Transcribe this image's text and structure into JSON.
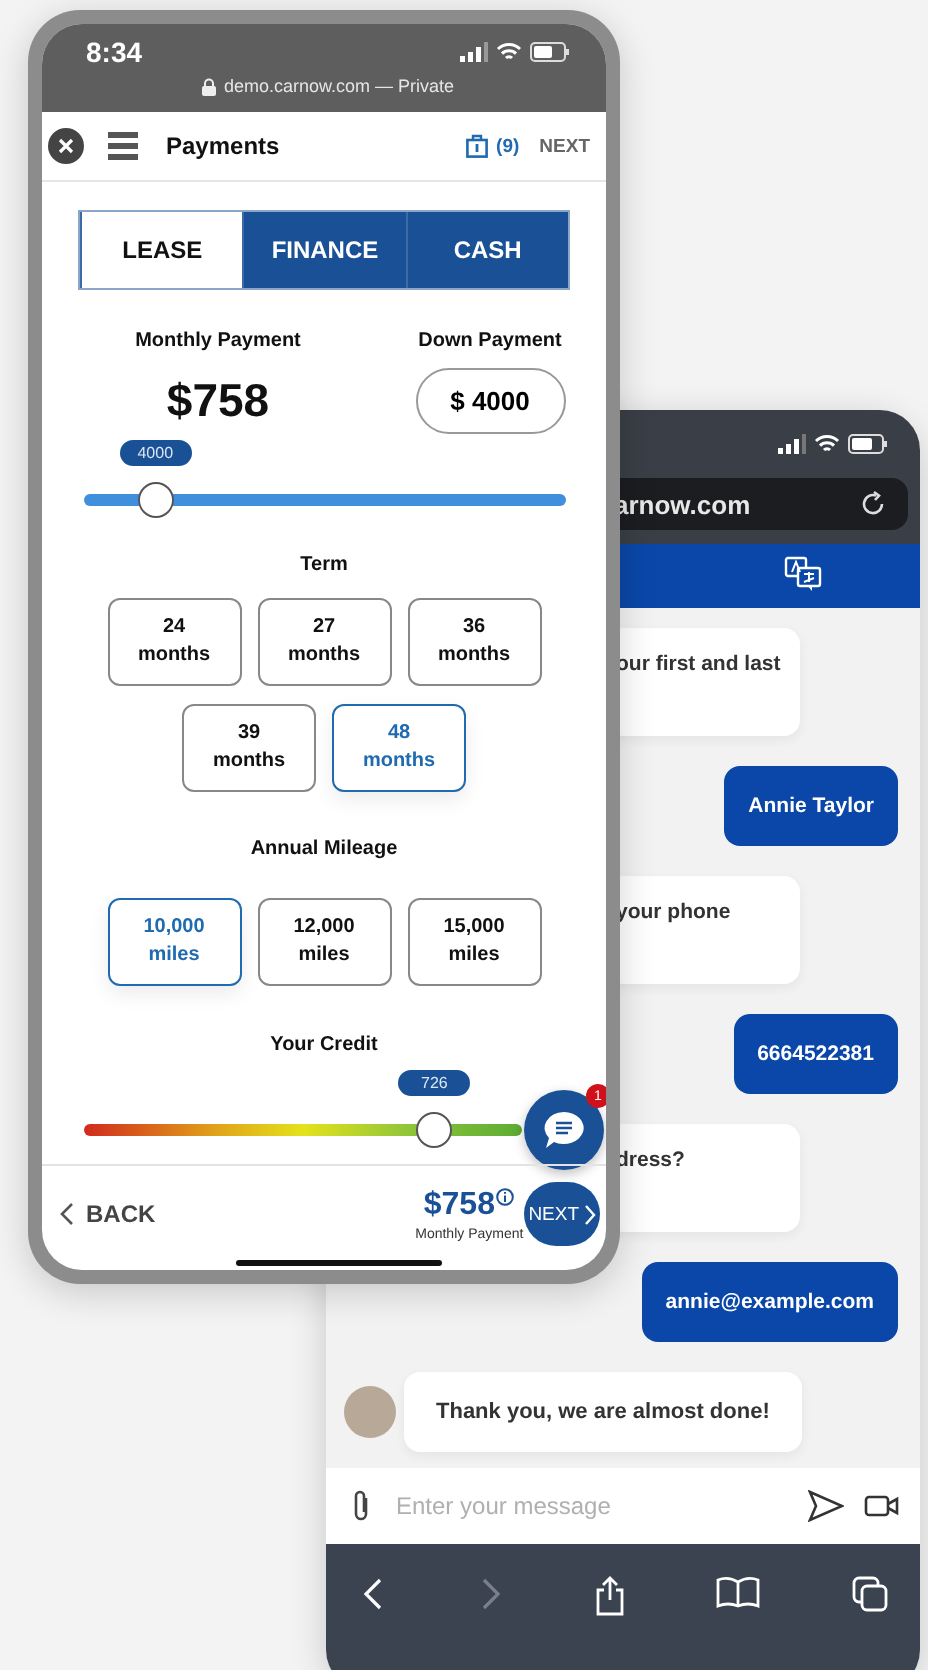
{
  "front_phone": {
    "status_bar": {
      "time": "8:34",
      "url": "demo.carnow.com — Private"
    },
    "header": {
      "title": "Payments",
      "cart_count": "(9)",
      "next": "NEXT"
    },
    "tabs": [
      {
        "label": "LEASE",
        "selected": true
      },
      {
        "label": "FINANCE",
        "selected": false
      },
      {
        "label": "CASH",
        "selected": false
      }
    ],
    "monthly_payment": {
      "label": "Monthly Payment",
      "value": "$758"
    },
    "down_payment": {
      "label": "Down Payment",
      "value": "$ 4000"
    },
    "down_payment_slider": {
      "level": 0.15,
      "reading": "4000"
    },
    "term": {
      "label": "Term",
      "options": [
        {
          "value": "24",
          "unit": "months",
          "selected": false
        },
        {
          "value": "27",
          "unit": "months",
          "selected": false
        },
        {
          "value": "36",
          "unit": "months",
          "selected": false
        },
        {
          "value": "39",
          "unit": "months",
          "selected": false
        },
        {
          "value": "48",
          "unit": "months",
          "selected": true
        }
      ]
    },
    "mileage": {
      "label": "Annual Mileage",
      "options": [
        {
          "value": "10,000",
          "unit": "miles",
          "selected": true
        },
        {
          "value": "12,000",
          "unit": "miles",
          "selected": false
        },
        {
          "value": "15,000",
          "unit": "miles",
          "selected": false
        }
      ]
    },
    "credit": {
      "label": "Your Credit",
      "level": 0.8,
      "reading": "726"
    },
    "chat_button": {
      "badge": "1"
    },
    "footer": {
      "back": "BACK",
      "amount": "$758",
      "caption": "Monthly Payment",
      "next": "NEXT"
    }
  },
  "back_phone": {
    "url": "arnow.com",
    "messages": [
      {
        "kind": "received",
        "text": "our first and last",
        "avatar": false
      },
      {
        "kind": "sent",
        "text": "Annie Taylor"
      },
      {
        "kind": "received",
        "text": "your phone",
        "avatar": false
      },
      {
        "kind": "sent",
        "text": "6664522381"
      },
      {
        "kind": "received",
        "text": "dress?",
        "avatar": false
      },
      {
        "kind": "sent",
        "text": "annie@example.com"
      },
      {
        "kind": "received",
        "text": "Thank you, we are almost done!",
        "avatar": true
      }
    ],
    "input": {
      "placeholder": "Enter your message"
    },
    "nav": [
      {
        "kind": "back",
        "disabled": false
      },
      {
        "kind": "forward",
        "disabled": true
      },
      {
        "kind": "share",
        "disabled": false
      },
      {
        "kind": "bookmarks",
        "disabled": false
      },
      {
        "kind": "tabs",
        "disabled": false
      }
    ]
  }
}
